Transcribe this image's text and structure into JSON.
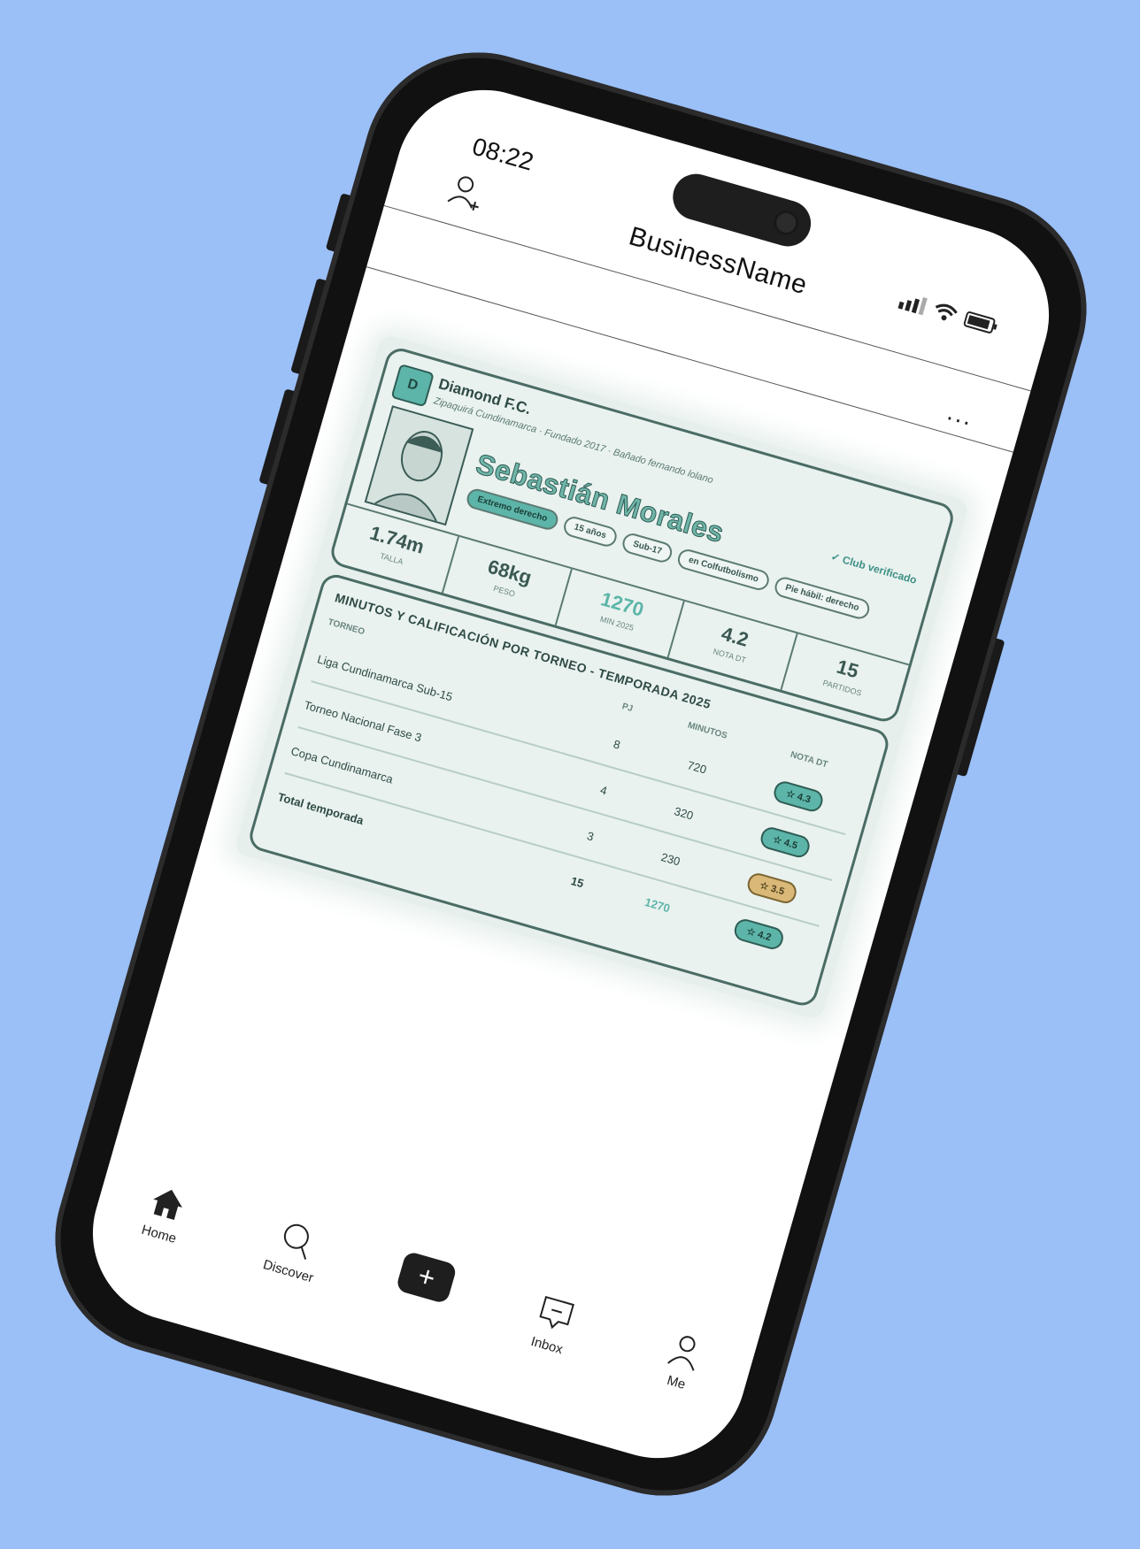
{
  "status_bar": {
    "time": "08:22",
    "icons": [
      "signal-icon",
      "wifi-icon",
      "battery-icon"
    ]
  },
  "header": {
    "brand": "BusinessName",
    "left_icon": "add-user-icon",
    "more_label": "..."
  },
  "card": {
    "club_badge": "D",
    "club_name": "Diamond F.C.",
    "club_subtitle": "Zipaquirá Cundinamarca · Fundado 2017 · Bañado fernando lolano",
    "player_name": "Sebastián Morales",
    "verified": "✓ Club verificado",
    "chips": [
      "Extremo derecho",
      "15 años",
      "Sub-17",
      "en Colfutbolismo",
      "Pie hábil: derecho"
    ],
    "stats": [
      {
        "value": "1.74m",
        "label": "TALLA"
      },
      {
        "value": "68kg",
        "label": "PESO"
      },
      {
        "value": "1270",
        "label": "MIN 2025"
      },
      {
        "value": "4.2",
        "label": "NOTA DT"
      },
      {
        "value": "15",
        "label": "PARTIDOS"
      }
    ]
  },
  "table": {
    "title": "MINUTOS Y CALIFICACIÓN POR TORNEO - TEMPORADA 2025",
    "headers": {
      "torneo": "TORNEO",
      "pj": "PJ",
      "minutos": "MINUTOS",
      "nota": "NOTA DT"
    },
    "rows": [
      {
        "torneo": "Liga Cundinamarca Sub-15",
        "pj": "8",
        "minutos": "720",
        "nota": "☆ 4.3"
      },
      {
        "torneo": "Torneo Nacional Fase 3",
        "pj": "4",
        "minutos": "320",
        "nota": "☆ 4.5"
      },
      {
        "torneo": "Copa Cundinamarca",
        "pj": "3",
        "minutos": "230",
        "nota": "☆ 3.5"
      },
      {
        "torneo": "Total temporada",
        "pj": "15",
        "minutos": "1270",
        "nota": "☆ 4.2"
      }
    ]
  },
  "tabbar": {
    "home": "Home",
    "discover": "Discover",
    "add": "+",
    "inbox": "Inbox",
    "me": "Me"
  },
  "colors": {
    "background": "#9bbff7",
    "accent": "#5cb5a8",
    "frame": "#111111"
  }
}
